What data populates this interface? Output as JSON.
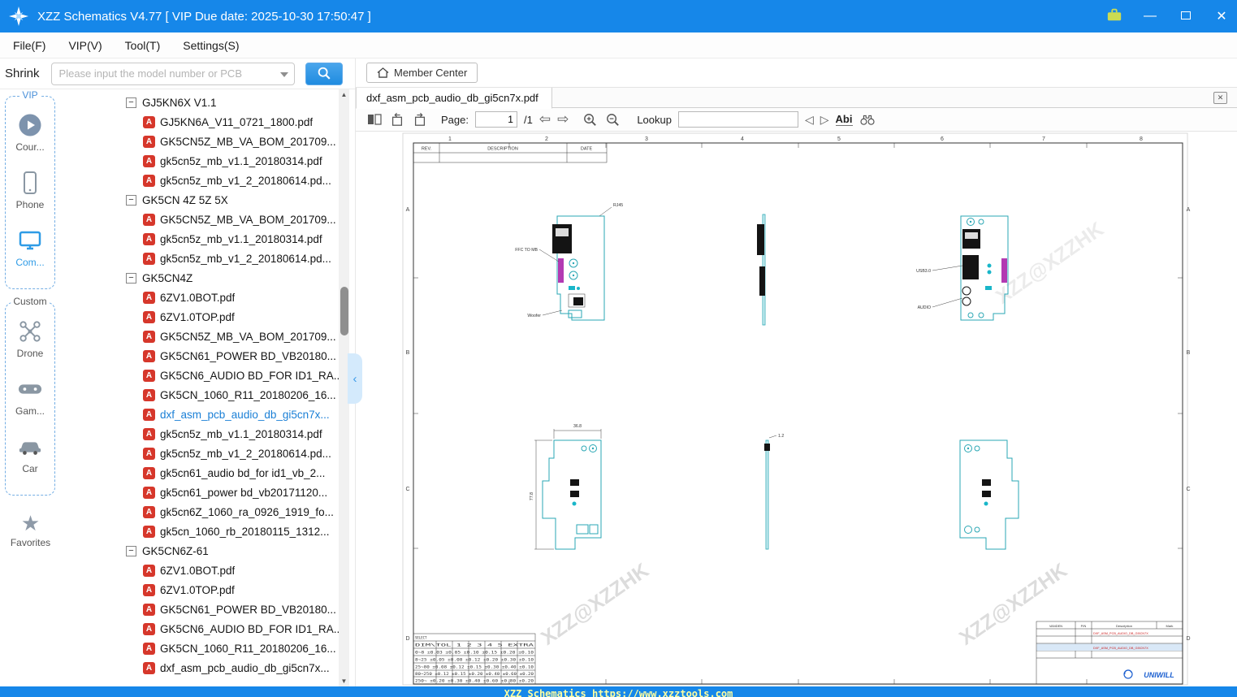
{
  "window": {
    "title": "XZZ Schematics V4.77 [ VIP Due date: 2025-10-30 17:50:47 ]"
  },
  "colors": {
    "titlebar": "#1687e9",
    "accent": "#2e9be6",
    "selected_file": "#1a7fd6",
    "pdf_icon": "#d6372b",
    "board_outline": "#2aa7b4",
    "ffc_connector": "#b23ab2",
    "statusbar_text": "#ffffa0"
  },
  "icons": {
    "minimize": "—",
    "close": "✕",
    "tab_close": "✕",
    "collapse_minus": "−",
    "prev_page": "⇦",
    "next_page": "⇨",
    "search_prev": "◁",
    "search_next": "▷",
    "scroll_up": "▲",
    "scroll_down": "▼",
    "panel_collapse": "‹",
    "favorites_star": "★"
  },
  "menu": {
    "items": [
      {
        "label": "File(F)"
      },
      {
        "label": "VIP(V)"
      },
      {
        "label": "Tool(T)"
      },
      {
        "label": "Settings(S)"
      }
    ]
  },
  "toolbar": {
    "shrink_label": "Shrink",
    "search_placeholder": "Please input the model number or PCB",
    "member_center_label": "Member Center"
  },
  "sidebar": {
    "vip_group": {
      "label": "VIP",
      "items": [
        {
          "label": "Cour..."
        },
        {
          "label": "Phone"
        },
        {
          "label": "Com..."
        }
      ]
    },
    "custom_group": {
      "label": "Custom",
      "items": [
        {
          "label": "Drone"
        },
        {
          "label": "Gam..."
        },
        {
          "label": "Car"
        }
      ]
    },
    "favorites_label": "Favorites"
  },
  "tree": {
    "rows": [
      {
        "type": "group",
        "label": "GJ5KN6X  V1.1"
      },
      {
        "type": "file",
        "label": "GJ5KN6A_V11_0721_1800.pdf"
      },
      {
        "type": "file",
        "label": "GK5CN5Z_MB_VA_BOM_201709..."
      },
      {
        "type": "file",
        "label": "gk5cn5z_mb_v1.1_20180314.pdf"
      },
      {
        "type": "file",
        "label": "gk5cn5z_mb_v1_2_20180614.pd..."
      },
      {
        "type": "group",
        "label": "GK5CN  4Z 5Z 5X"
      },
      {
        "type": "file",
        "label": "GK5CN5Z_MB_VA_BOM_201709..."
      },
      {
        "type": "file",
        "label": "gk5cn5z_mb_v1.1_20180314.pdf"
      },
      {
        "type": "file",
        "label": "gk5cn5z_mb_v1_2_20180614.pd..."
      },
      {
        "type": "group",
        "label": "GK5CN4Z"
      },
      {
        "type": "file",
        "label": "6ZV1.0BOT.pdf"
      },
      {
        "type": "file",
        "label": "6ZV1.0TOP.pdf"
      },
      {
        "type": "file",
        "label": "GK5CN5Z_MB_VA_BOM_201709..."
      },
      {
        "type": "file",
        "label": "GK5CN61_POWER BD_VB20180..."
      },
      {
        "type": "file",
        "label": "GK5CN6_AUDIO BD_FOR ID1_RA..."
      },
      {
        "type": "file",
        "label": "GK5CN_1060_R11_20180206_16..."
      },
      {
        "type": "file",
        "label": "dxf_asm_pcb_audio_db_gi5cn7x...",
        "selected": true
      },
      {
        "type": "file",
        "label": "gk5cn5z_mb_v1.1_20180314.pdf"
      },
      {
        "type": "file",
        "label": "gk5cn5z_mb_v1_2_20180614.pd..."
      },
      {
        "type": "file",
        "label": "gk5cn61_audio bd_for id1_vb_2..."
      },
      {
        "type": "file",
        "label": "gk5cn61_power bd_vb20171120..."
      },
      {
        "type": "file",
        "label": "gk5cn6Z_1060_ra_0926_1919_fo..."
      },
      {
        "type": "file",
        "label": "gk5cn_1060_rb_20180115_1312..."
      },
      {
        "type": "group",
        "label": "GK5CN6Z-61"
      },
      {
        "type": "file",
        "label": "6ZV1.0BOT.pdf"
      },
      {
        "type": "file",
        "label": "6ZV1.0TOP.pdf"
      },
      {
        "type": "file",
        "label": "GK5CN61_POWER BD_VB20180..."
      },
      {
        "type": "file",
        "label": "GK5CN6_AUDIO BD_FOR ID1_RA..."
      },
      {
        "type": "file",
        "label": "GK5CN_1060_R11_20180206_16..."
      },
      {
        "type": "file",
        "label": "dxf_asm_pcb_audio_db_gi5cn7x..."
      }
    ]
  },
  "document": {
    "tab_title": "dxf_asm_pcb_audio_db_gi5cn7x.pdf",
    "page_label": "Page:",
    "page_value": "1",
    "page_total": "/1",
    "lookup_label": "Lookup",
    "abi_label": "Abi"
  },
  "drawing": {
    "column_labels": [
      "1",
      "2",
      "3",
      "4",
      "5",
      "6",
      "7",
      "8"
    ],
    "row_labels": [
      "A",
      "B",
      "C",
      "D"
    ],
    "rev_table": {
      "rev": "REV.",
      "description": "DESCRIPTION",
      "date": "DATE"
    },
    "callouts": {
      "rj45": "RJ45",
      "ffc_to_mb": "FFC TO MB",
      "woofer": "Woofer",
      "usb30": "USB3.0",
      "audio": "AUDIO"
    },
    "dimensions": {
      "board_width": "36.8",
      "board_height": "77.8",
      "board_thickness": "1.2"
    },
    "watermark": "XZZ@XZZHK",
    "tolerance_table": {
      "title": "SELECT",
      "header": "DIM\\TOL 1 2 3 4 5 EXTRA",
      "rows": [
        "0~8 ±0.03 ±0.05 ±0.10 ±0.15 ±0.20 ±0.10",
        "8~25 ±0.05 ±0.08 ±0.12 ±0.20 ±0.30 ±0.10",
        "25~80 ±0.08 ±0.12 ±0.15 ±0.30 ±0.40 ±0.10",
        "80~250 ±0.12 ±0.15 ±0.20 ±0.40 ±0.60 ±0.20",
        "250~ ±0.20 ±0.30 ±0.40 ±0.60 ±0.80 ±0.20"
      ]
    },
    "title_block": {
      "vendor": "VANDEN",
      "pn": "P/N",
      "description": "Description",
      "mark": "Mark",
      "part_name": "DXF_ASM_PCB_AUDIO_DB_GI5CN7X",
      "logo": "UNIWILL"
    }
  },
  "statusbar": {
    "text": "XZZ Schematics https://www.xzztools.com"
  }
}
